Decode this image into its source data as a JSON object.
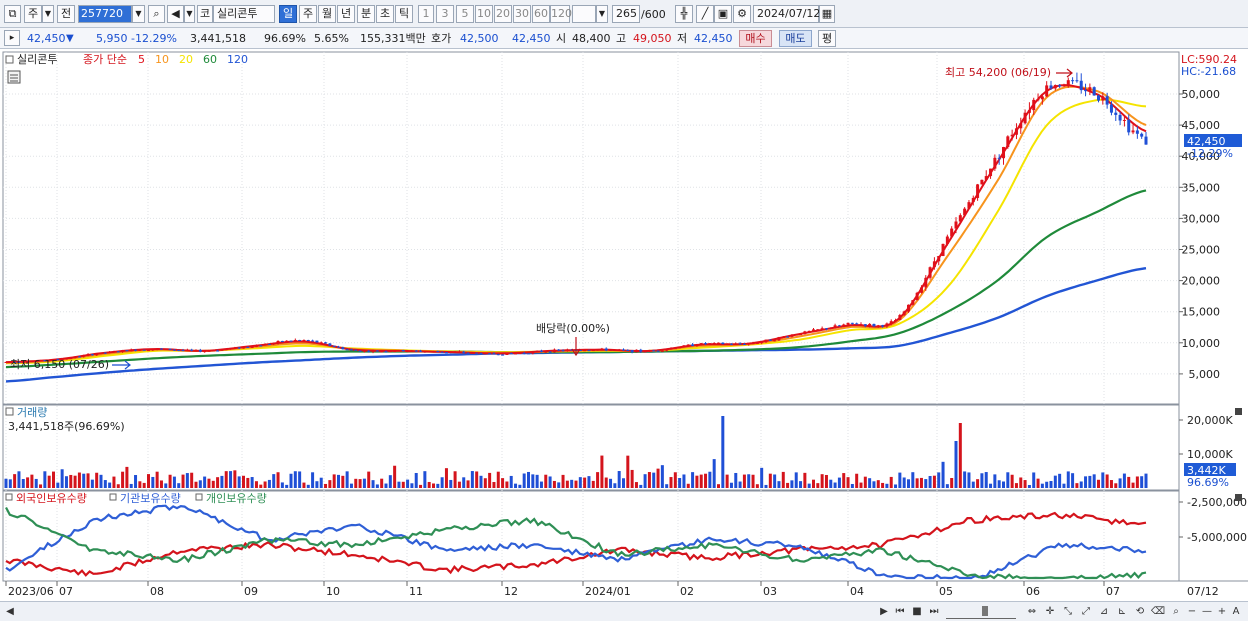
{
  "toolbar": {
    "type_label": "주",
    "prev_label": "전",
    "code": "257720",
    "stock_name_prefix": "코",
    "stock_name": "실리콘투",
    "periods": [
      "일",
      "주",
      "월",
      "년",
      "분",
      "초",
      "틱"
    ],
    "active_period": "일",
    "intervals": [
      "1",
      "3",
      "5",
      "10",
      "20",
      "30",
      "60",
      "120"
    ],
    "count_value": "265",
    "count_total": "/600",
    "date": "2024/07/12"
  },
  "quote": {
    "price": "42,450",
    "change_arrow": "▼",
    "change": "5,950",
    "change_pct": "-12.29%",
    "volume": "3,441,518",
    "volume_ratio": "96.69%",
    "turnover_pct": "5.65%",
    "amount": "155,331백만",
    "bid_label": "호가",
    "bid": "42,500",
    "ask": "42,450",
    "open_label": "시",
    "open": "48,400",
    "high_label": "고",
    "high": "49,050",
    "low_label": "저",
    "low": "42,450",
    "buy_label": "매수",
    "sell_label": "매도",
    "eval_label": "평"
  },
  "price_panel": {
    "legend_name": "실리콘투",
    "legend_ma_label": "종가 단순",
    "ma_periods": [
      "5",
      "10",
      "20",
      "60",
      "120"
    ],
    "ma_colors": [
      "#e0101a",
      "#f7941d",
      "#f5e400",
      "#1f8a3a",
      "#2255d4"
    ],
    "lc_label": "LC:590.24",
    "hc_label": "HC:-21.68",
    "current_price_tag": "42,450",
    "current_pct_tag": "-12.29%",
    "high_annotation": "최고 54,200 (06/19)",
    "low_annotation": "최저 6,150 (07/26)",
    "dividend_annotation": "배당락(0.00%)",
    "y_ticks": [
      "50,000",
      "45,000",
      "40,000",
      "35,000",
      "30,000",
      "25,000",
      "20,000",
      "15,000",
      "10,000",
      "5,000"
    ]
  },
  "volume_panel": {
    "title": "거래량",
    "summary": "3,441,518주(96.69%)",
    "y_ticks": [
      "20,000K",
      "10,000K"
    ],
    "tag_value": "3,442K",
    "tag_pct": "96.69%"
  },
  "holding_panel": {
    "series_labels": [
      "외국인보유수량",
      "기관보유수량",
      "개인보유수량"
    ],
    "series_colors": [
      "#d4141c",
      "#2f5fd6",
      "#2f8f55"
    ],
    "y_ticks": [
      "-2,500,000",
      "-5,000,000"
    ]
  },
  "x_axis": {
    "labels": [
      "2023/06",
      "07",
      "08",
      "09",
      "10",
      "11",
      "12",
      "2024/01",
      "02",
      "03",
      "04",
      "05",
      "06",
      "07"
    ],
    "end_date": "07/12"
  },
  "chart_data": {
    "type": "candlestick",
    "series": [
      {
        "name": "실리콘투",
        "values": [
          6900,
          7300,
          8400,
          9000,
          8700,
          9500,
          10400,
          8800,
          8700,
          8500,
          8200,
          8700,
          8900,
          8700,
          9800,
          9900,
          11500,
          13000,
          14000,
          27000,
          40000,
          51000,
          50000,
          42450
        ]
      },
      {
        "name": "5",
        "values": [
          6900,
          7300,
          8400,
          9000,
          8700,
          9500,
          10200,
          8900,
          8700,
          8500,
          8300,
          8700,
          8900,
          8700,
          9700,
          9900,
          11400,
          12800,
          13800,
          26000,
          39000,
          50500,
          50000,
          44000
        ]
      },
      {
        "name": "10",
        "values": [
          6800,
          7200,
          8200,
          8900,
          8700,
          9300,
          9900,
          9000,
          8700,
          8500,
          8400,
          8600,
          8800,
          8700,
          9500,
          9800,
          11000,
          12500,
          13500,
          24000,
          36000,
          49500,
          50500,
          45000
        ]
      },
      {
        "name": "20",
        "values": [
          6700,
          7000,
          7900,
          8700,
          8700,
          9100,
          9500,
          9100,
          8800,
          8600,
          8500,
          8600,
          8700,
          8700,
          9200,
          9700,
          10500,
          12000,
          13000,
          19000,
          31000,
          45000,
          49000,
          48000
        ]
      },
      {
        "name": "60",
        "values": [
          6100,
          6500,
          7000,
          7500,
          7900,
          8200,
          8500,
          8600,
          8600,
          8600,
          8500,
          8500,
          8500,
          8600,
          8700,
          8900,
          9300,
          10200,
          11500,
          15000,
          20000,
          27000,
          31000,
          34500
        ]
      },
      {
        "name": "120",
        "values": [
          3800,
          4500,
          5200,
          5800,
          6300,
          6800,
          7200,
          7600,
          7900,
          8100,
          8300,
          8400,
          8500,
          8600,
          8700,
          8800,
          8900,
          9100,
          9500,
          11500,
          14000,
          17500,
          20000,
          22000
        ]
      }
    ],
    "title": "실리콘투",
    "ylim": [
      2500,
      55000
    ]
  }
}
